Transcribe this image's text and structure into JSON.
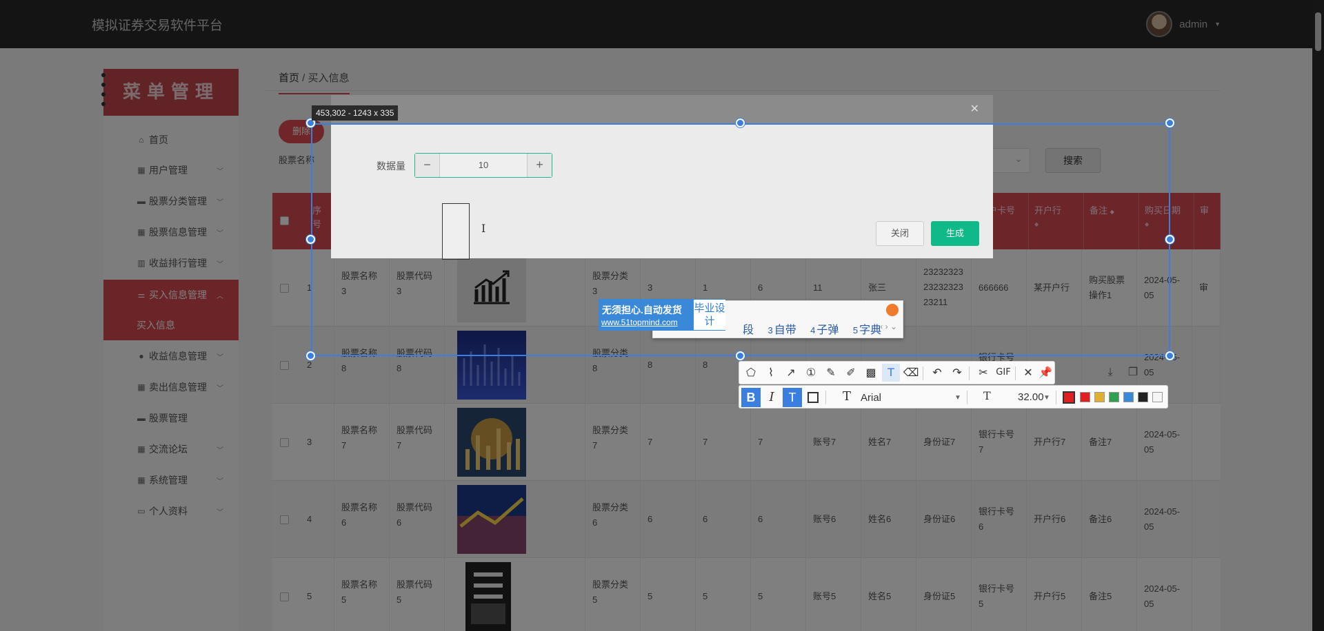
{
  "app": {
    "title": "模拟证券交易软件平台",
    "user": "admin"
  },
  "sidebar": {
    "banner": "菜单管理",
    "items": [
      {
        "label": "首页",
        "icon": "home-icon"
      },
      {
        "label": "用户管理",
        "icon": "grid-icon"
      },
      {
        "label": "股票分类管理",
        "icon": "card-icon"
      },
      {
        "label": "股票信息管理",
        "icon": "grid-icon"
      },
      {
        "label": "收益排行管理",
        "icon": "chart-icon"
      },
      {
        "label": "买入信息管理",
        "icon": "sliders-icon"
      },
      {
        "label": "买入信息",
        "icon": ""
      },
      {
        "label": "收益信息管理",
        "icon": "pin-icon"
      },
      {
        "label": "卖出信息管理",
        "icon": "grid-icon"
      },
      {
        "label": "股票管理",
        "icon": "card-icon"
      },
      {
        "label": "交流论坛",
        "icon": "grid-icon"
      },
      {
        "label": "系统管理",
        "icon": "grid-icon"
      },
      {
        "label": "个人资料",
        "icon": "form-icon"
      }
    ]
  },
  "breadcrumb": {
    "home": "首页",
    "sep": " / ",
    "current": "买入信息"
  },
  "toolbar": {
    "add_label": "删除",
    "search_label": "股票名称",
    "search_button": "搜索"
  },
  "table": {
    "headers": [
      "序号",
      "开户卡号",
      "开户行",
      "备注",
      "购买日期",
      "审"
    ],
    "rows": [
      {
        "idx": "1",
        "name": "股票名称3",
        "code": "股票代码3",
        "cat": "股票分类3",
        "a": "3",
        "b": "1",
        "c": "6",
        "d": "11",
        "account": "张三",
        "id": "232323232323232323211",
        "card": "666666",
        "bank": "某开户行",
        "note": "购买股票操作1",
        "date": "2024-05-05",
        "extra": "审"
      },
      {
        "idx": "2",
        "name": "股票名称8",
        "code": "股票代码8",
        "cat": "股票分类8",
        "a": "8",
        "b": "8",
        "c": "",
        "d": "",
        "account": "",
        "id": "",
        "card": "银行卡号8",
        "bank": "",
        "note": "",
        "date": "2024-05-05",
        "extra": ""
      },
      {
        "idx": "3",
        "name": "股票名称7",
        "code": "股票代码7",
        "cat": "股票分类7",
        "a": "7",
        "b": "7",
        "c": "7",
        "d": "账号7",
        "account": "姓名7",
        "id": "身份证7",
        "card": "银行卡号7",
        "bank": "开户行7",
        "note": "备注7",
        "date": "2024-05-05",
        "extra": ""
      },
      {
        "idx": "4",
        "name": "股票名称6",
        "code": "股票代码6",
        "cat": "股票分类6",
        "a": "6",
        "b": "6",
        "c": "6",
        "d": "账号6",
        "account": "姓名6",
        "id": "身份证6",
        "card": "银行卡号6",
        "bank": "开户行6",
        "note": "备注6",
        "date": "2024-05-05",
        "extra": ""
      },
      {
        "idx": "5",
        "name": "股票名称5",
        "code": "股票代码5",
        "cat": "股票分类5",
        "a": "5",
        "b": "5",
        "c": "5",
        "d": "账号5",
        "account": "姓名5",
        "id": "身份证5",
        "card": "银行卡号5",
        "bank": "开户行5",
        "note": "备注5",
        "date": "2024-05-05",
        "extra": ""
      }
    ]
  },
  "modal": {
    "field_label": "数据量",
    "quantity": "10",
    "close_label": "关闭",
    "generate_label": "生成"
  },
  "screenshot_tool": {
    "selection_info": "453,302 - 1243 x 335",
    "font": "Arial",
    "font_size": "32.00",
    "colors": [
      "#e02020",
      "#e02020",
      "#e0b030",
      "#30a050",
      "#3a88d8",
      "#222222",
      "#f5f5f5"
    ]
  },
  "ime": {
    "candidates": [
      {
        "n": "3",
        "w": "自带"
      },
      {
        "n": "4",
        "w": "子弹"
      },
      {
        "n": "5",
        "w": "字典"
      }
    ],
    "partial": "段"
  },
  "ad": {
    "line1": "无须担心.自动发货",
    "line2": "www.51topmind.com",
    "box": "毕业设计"
  }
}
